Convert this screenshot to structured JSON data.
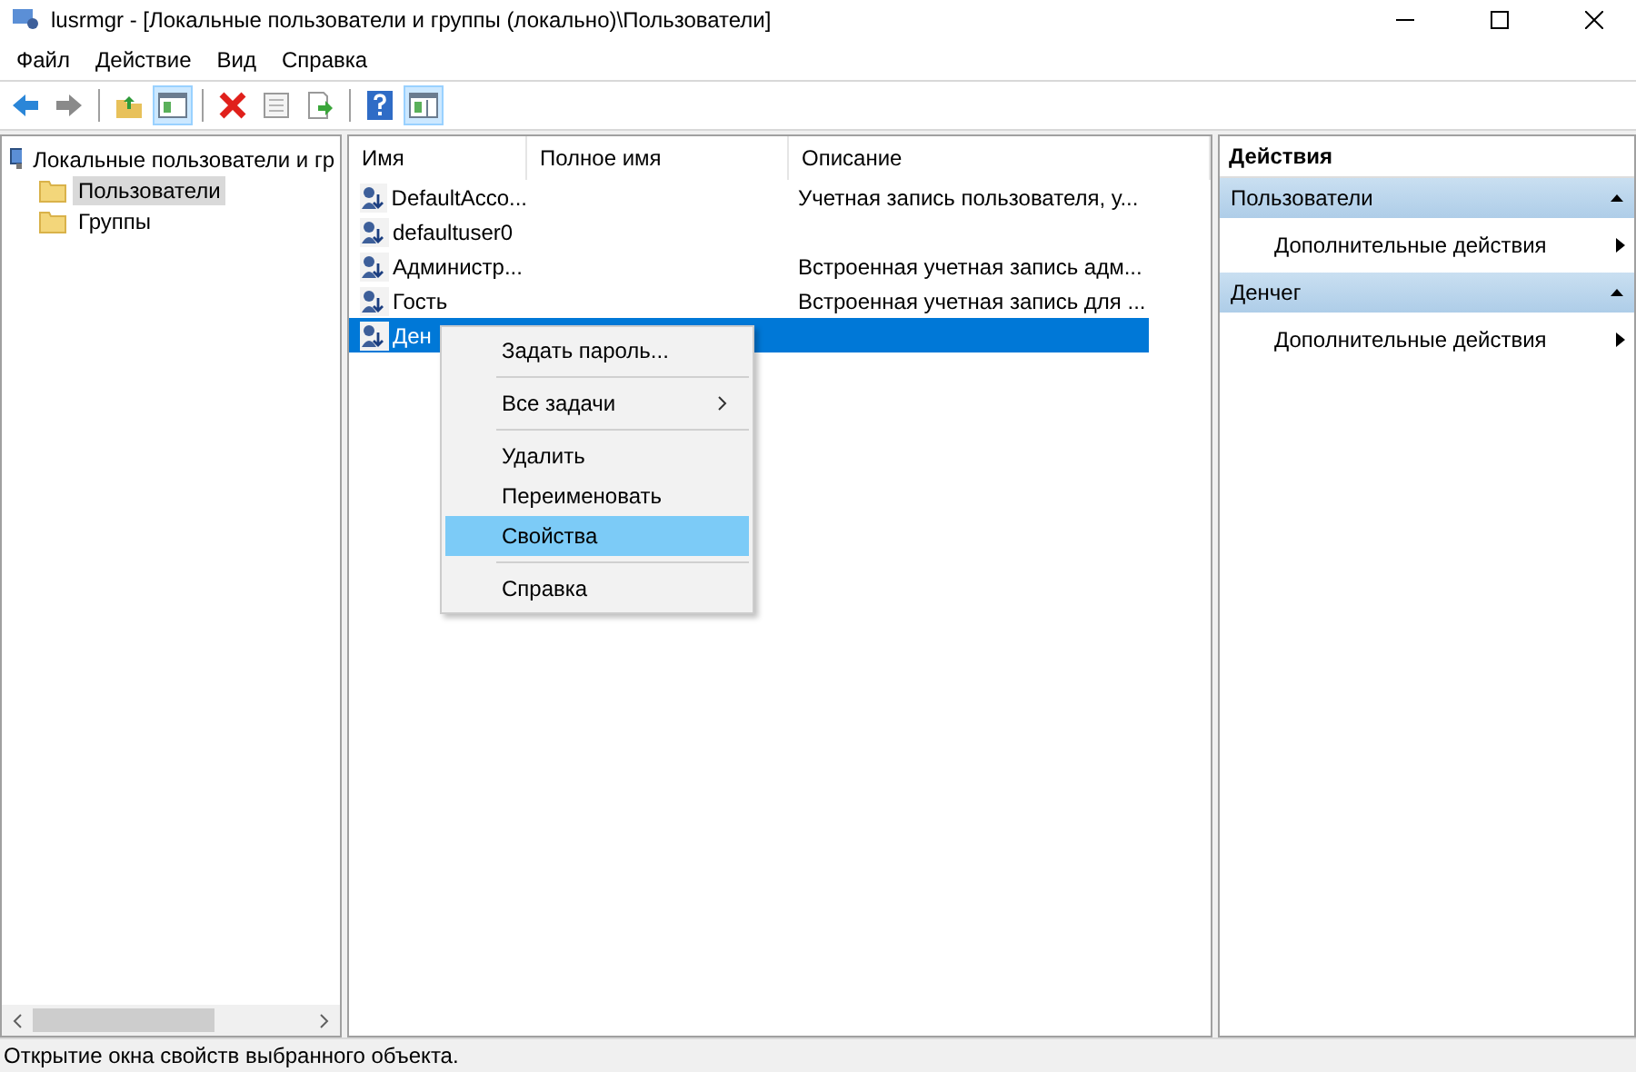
{
  "window": {
    "title": "lusrmgr - [Локальные пользователи и группы (локально)\\Пользователи]"
  },
  "menu": [
    "Файл",
    "Действие",
    "Вид",
    "Справка"
  ],
  "toolbar": [
    {
      "kind": "back",
      "selected": false
    },
    {
      "kind": "forward",
      "selected": false
    },
    {
      "kind": "sep"
    },
    {
      "kind": "up",
      "selected": false
    },
    {
      "kind": "tree",
      "selected": true
    },
    {
      "kind": "sep"
    },
    {
      "kind": "delete",
      "selected": false
    },
    {
      "kind": "properties",
      "selected": false
    },
    {
      "kind": "export",
      "selected": false
    },
    {
      "kind": "sep"
    },
    {
      "kind": "help",
      "selected": false
    },
    {
      "kind": "pane",
      "selected": true
    }
  ],
  "tree": {
    "label": "Локальные пользователи и гр",
    "children": [
      {
        "label": "Пользователи",
        "selected": true
      },
      {
        "label": "Группы",
        "selected": false
      }
    ]
  },
  "table": {
    "columns": [
      "Имя",
      "Полное имя",
      "Описание"
    ],
    "rows": [
      {
        "name": "DefaultAcco...",
        "full_name": "",
        "description": "Учетная запись пользователя, у...",
        "selected": false
      },
      {
        "name": "defaultuser0",
        "full_name": "",
        "description": "",
        "selected": false
      },
      {
        "name": "Администр...",
        "full_name": "",
        "description": "Встроенная учетная запись адм...",
        "selected": false
      },
      {
        "name": "Гость",
        "full_name": "",
        "description": "Встроенная учетная запись для ...",
        "selected": false
      },
      {
        "name": "Ден",
        "full_name": "",
        "description": "",
        "selected": true
      }
    ]
  },
  "context_menu": [
    {
      "kind": "item",
      "label": "Задать пароль...",
      "selected": false
    },
    {
      "kind": "separator"
    },
    {
      "kind": "submenu",
      "label": "Все задачи",
      "selected": false
    },
    {
      "kind": "separator"
    },
    {
      "kind": "item",
      "label": "Удалить",
      "selected": false
    },
    {
      "kind": "item",
      "label": "Переименовать",
      "selected": false
    },
    {
      "kind": "item",
      "label": "Свойства",
      "selected": true
    },
    {
      "kind": "separator"
    },
    {
      "kind": "item",
      "label": "Справка",
      "selected": false
    }
  ],
  "actions": {
    "title": "Действия",
    "sections": [
      {
        "title": "Пользователи",
        "expanded": true,
        "items": [
          "Дополнительные действия"
        ]
      },
      {
        "title": "Денчег",
        "expanded": true,
        "items": [
          "Дополнительные действия"
        ]
      }
    ]
  },
  "status_bar": "Открытие окна свойств выбранного объекта."
}
